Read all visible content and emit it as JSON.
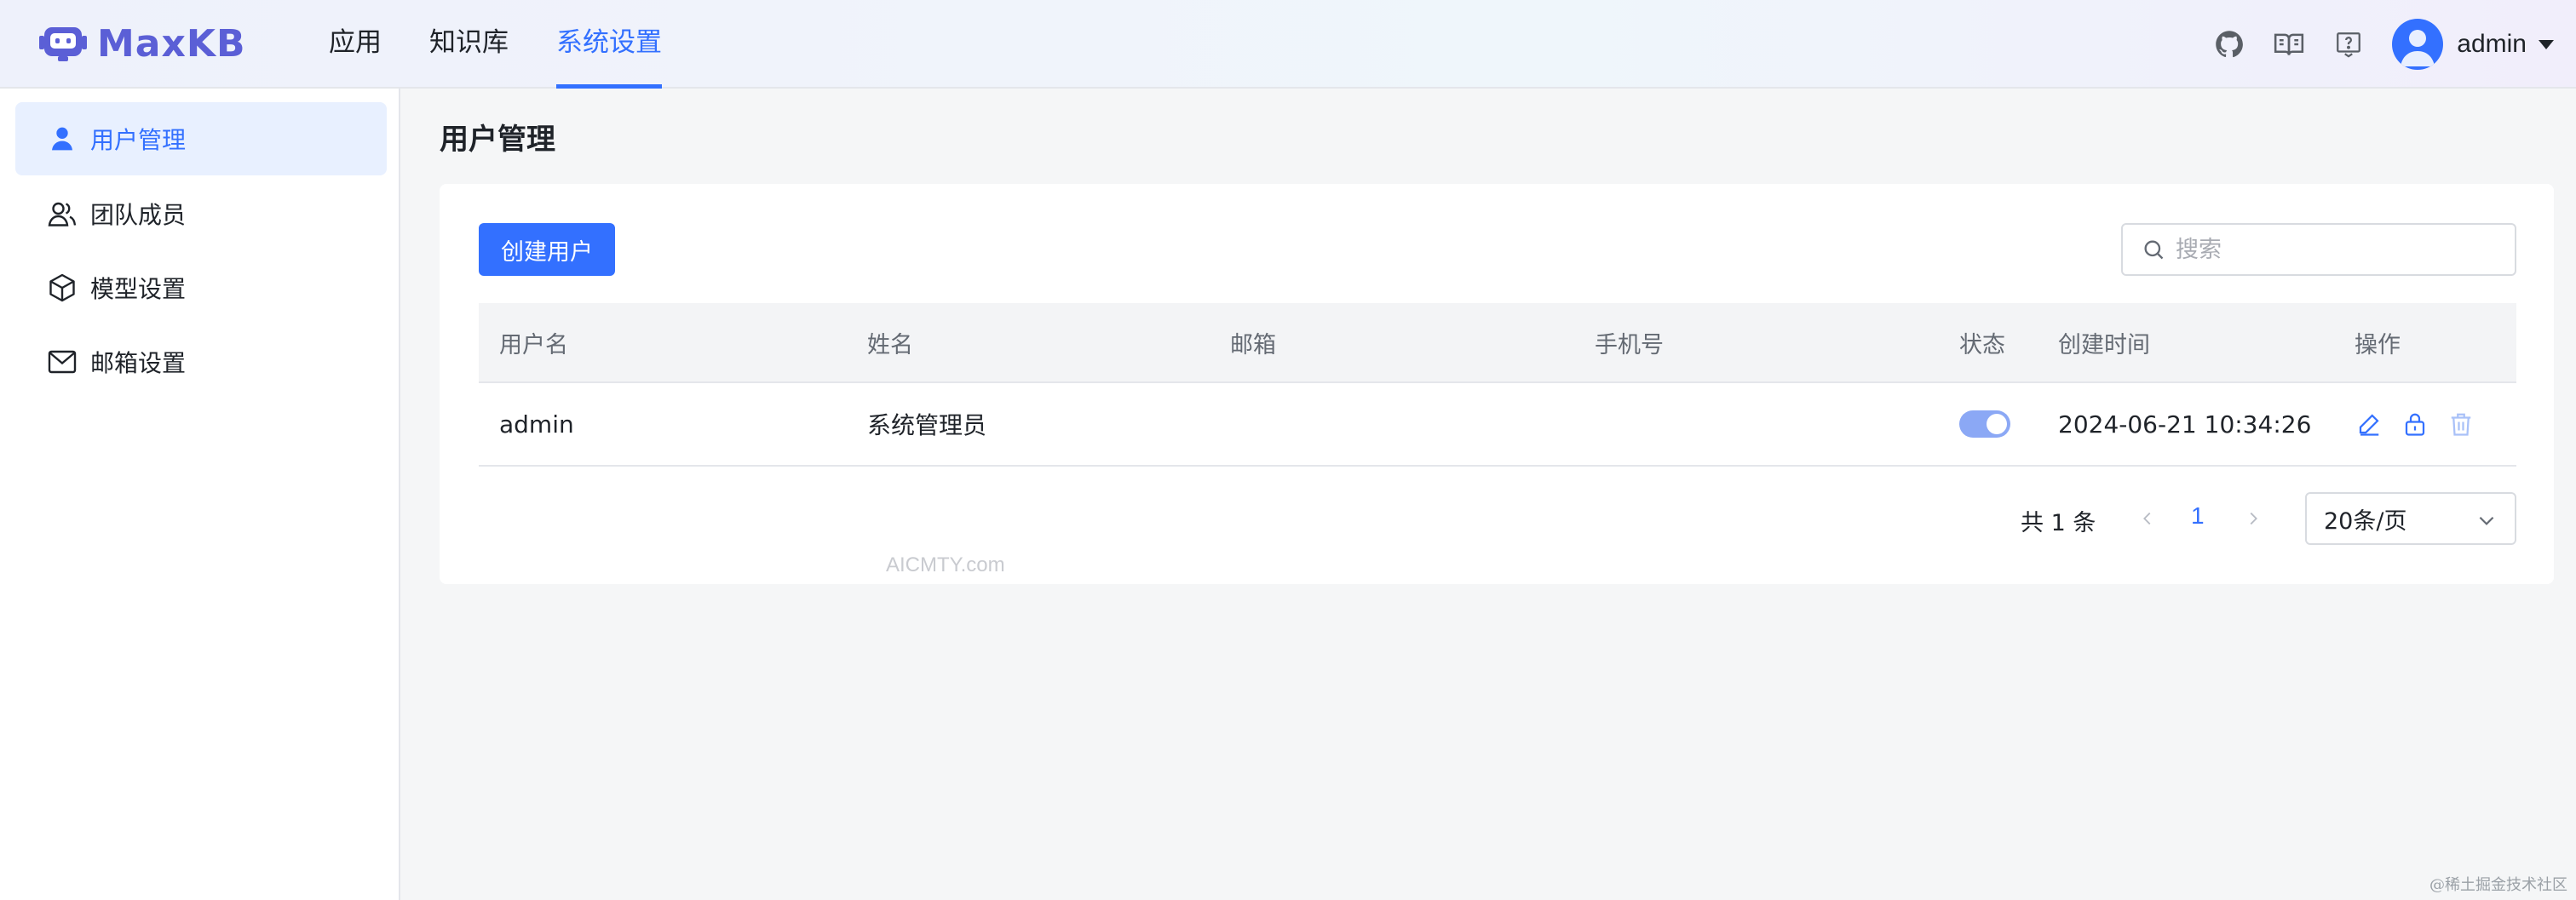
{
  "app": {
    "name": "MaxKB"
  },
  "header": {
    "nav": [
      {
        "label": "应用"
      },
      {
        "label": "知识库"
      },
      {
        "label": "系统设置"
      }
    ],
    "active_nav": "系统设置",
    "icons": [
      "github-icon",
      "book-icon",
      "help-icon"
    ],
    "user": {
      "name": "admin"
    }
  },
  "sidebar": {
    "items": [
      {
        "label": "用户管理",
        "icon": "user-icon",
        "active": true
      },
      {
        "label": "团队成员",
        "icon": "team-icon",
        "active": false
      },
      {
        "label": "模型设置",
        "icon": "cube-icon",
        "active": false
      },
      {
        "label": "邮箱设置",
        "icon": "mail-icon",
        "active": false
      }
    ]
  },
  "main": {
    "title": "用户管理",
    "create_button": "创建用户",
    "search": {
      "placeholder": "搜索",
      "value": ""
    },
    "table": {
      "columns": [
        "用户名",
        "姓名",
        "邮箱",
        "手机号",
        "状态",
        "创建时间",
        "操作"
      ],
      "rows": [
        {
          "username": "admin",
          "name": "系统管理员",
          "email": "",
          "phone": "",
          "status_enabled": true,
          "created": "2024-06-21 10:34:26",
          "actions": [
            "edit-icon",
            "lock-icon",
            "delete-icon"
          ]
        }
      ]
    },
    "pagination": {
      "total_text": "共 1 条",
      "current_page": "1",
      "page_size": "20条/页"
    }
  },
  "watermark": "AICMTY.com",
  "corner_mark": "@稀土掘金技术社区",
  "colors": {
    "primary": "#3370ff",
    "logo": "#5b5fd6",
    "toggle_on": "#8ba8f5"
  }
}
